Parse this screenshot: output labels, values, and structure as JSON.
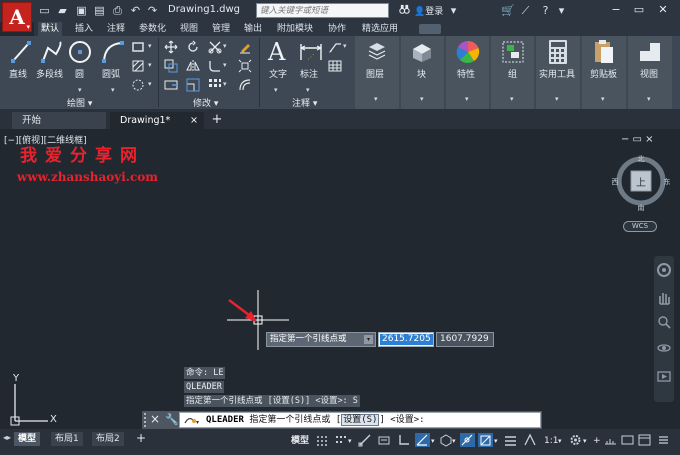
{
  "app": {
    "logo_letter": "A",
    "document_title": "Drawing1.dwg",
    "search_placeholder": "键入关键字或短语",
    "login_label": "登录"
  },
  "ribbon_tabs": [
    "默认",
    "插入",
    "注释",
    "参数化",
    "视图",
    "管理",
    "输出",
    "附加模块",
    "协作",
    "精选应用"
  ],
  "ribbon": {
    "draw": {
      "line": "直线",
      "polyline": "多段线",
      "circle": "圆",
      "arc": "圆弧",
      "panel_title": "绘图"
    },
    "modify": {
      "panel_title": "修改"
    },
    "annotation": {
      "text": "文字",
      "dimension": "标注",
      "panel_title": "注释"
    },
    "layers": "图层",
    "block": "块",
    "properties": "特性",
    "groups": "组",
    "utilities": "实用工具",
    "clipboard": "剪贴板",
    "view": "视图"
  },
  "file_tabs": {
    "start": "开始",
    "drawing": "Drawing1*"
  },
  "viewport": {
    "label": "[−][俯视][二维线框]",
    "controls": "− ▭ ×"
  },
  "watermark": {
    "title": "我爱分享网",
    "url": "www.zhanshaoyi.com"
  },
  "viewcube": {
    "top": "上",
    "north": "北",
    "south": "南",
    "east": "东",
    "west": "西",
    "wcs": "WCS"
  },
  "dynamic_input": {
    "prompt": "指定第一个引线点或",
    "x_value": "2615.7205",
    "y_value": "1607.7929"
  },
  "command_history": [
    "命令: LE",
    "QLEADER",
    "指定第一个引线点或 [设置(S)] <设置>: S"
  ],
  "command_line": {
    "command": "QLEADER",
    "prompt_text": "指定第一个引线点或 [",
    "option": "设置(S)",
    "suffix": "] <设置>:"
  },
  "layout_tabs": [
    "模型",
    "布局1",
    "布局2"
  ],
  "status": {
    "model_label": "模型",
    "scale": "1:1"
  },
  "colors": {
    "logo_red": "#c4231e",
    "canvas": "#212830",
    "ribbon": "#3e4854",
    "watermark_red": "#e8232d",
    "highlight_blue": "#2c7fd3"
  }
}
